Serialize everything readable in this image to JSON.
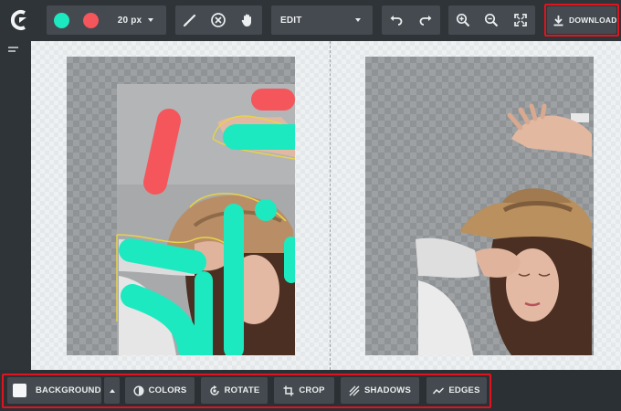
{
  "toolbar": {
    "colors": {
      "primary": "#1de9c0",
      "secondary": "#f4565c"
    },
    "brush_size": "20 px",
    "mode": "EDIT",
    "download_label": "DOWNLOAD",
    "icons": [
      "pen-icon",
      "eraser-icon",
      "hand-icon",
      "undo-icon",
      "redo-icon",
      "zoom-in-icon",
      "zoom-out-icon",
      "fullscreen-icon",
      "download-icon"
    ]
  },
  "bottombar": {
    "background_label": "BACKGROUND",
    "colors_label": "COLORS",
    "rotate_label": "ROTATE",
    "crop_label": "CROP",
    "shadows_label": "SHADOWS",
    "edges_label": "EDGES"
  },
  "theme": {
    "accent_highlight": "#e0141f",
    "keep_stroke": "#1de9c0",
    "remove_stroke": "#f4565c"
  }
}
